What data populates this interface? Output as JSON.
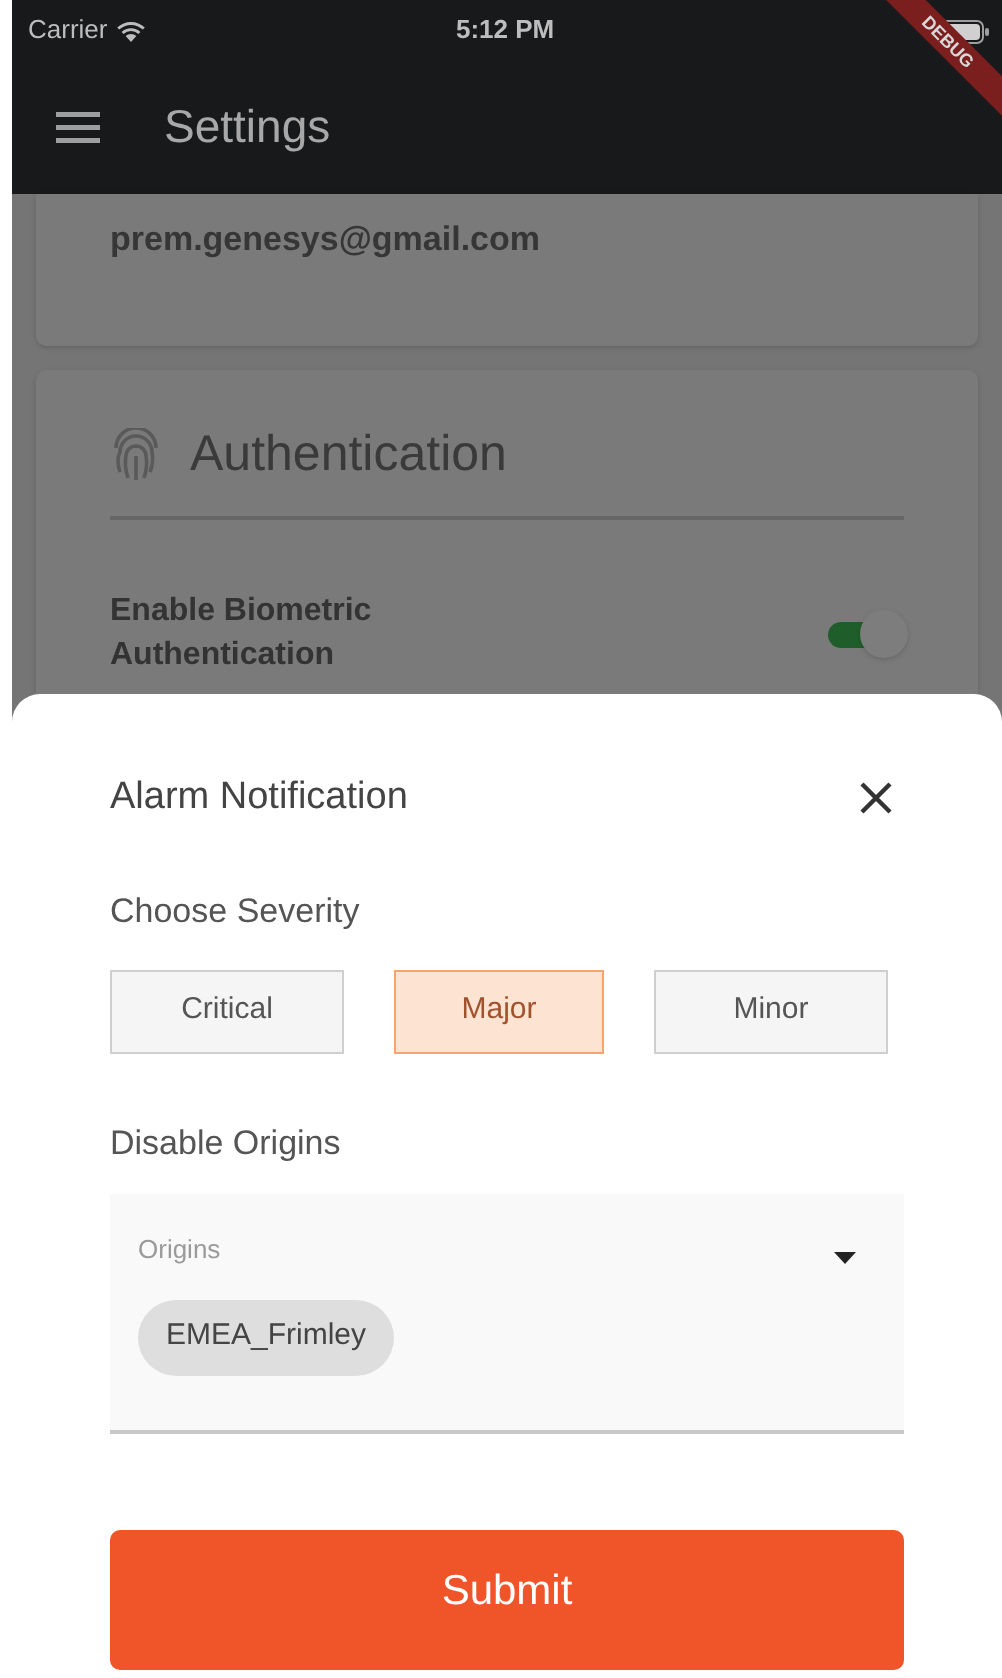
{
  "status_bar": {
    "carrier": "Carrier",
    "time": "5:12 PM"
  },
  "app_bar": {
    "title": "Settings"
  },
  "debug_banner": "DEBUG",
  "account_card": {
    "email": "prem.genesys@gmail.com"
  },
  "auth_card": {
    "title": "Authentication",
    "toggle": {
      "label": "Enable Biometric Authentication",
      "on": true
    }
  },
  "sheet": {
    "title": "Alarm Notification",
    "severity_label": "Choose Severity",
    "severities": [
      {
        "label": "Critical",
        "selected": false
      },
      {
        "label": "Major",
        "selected": true
      },
      {
        "label": "Minor",
        "selected": false
      }
    ],
    "origins_label": "Disable Origins",
    "origins_field": {
      "label": "Origins",
      "chips": [
        "EMEA_Frimley"
      ]
    },
    "submit": "Submit"
  }
}
